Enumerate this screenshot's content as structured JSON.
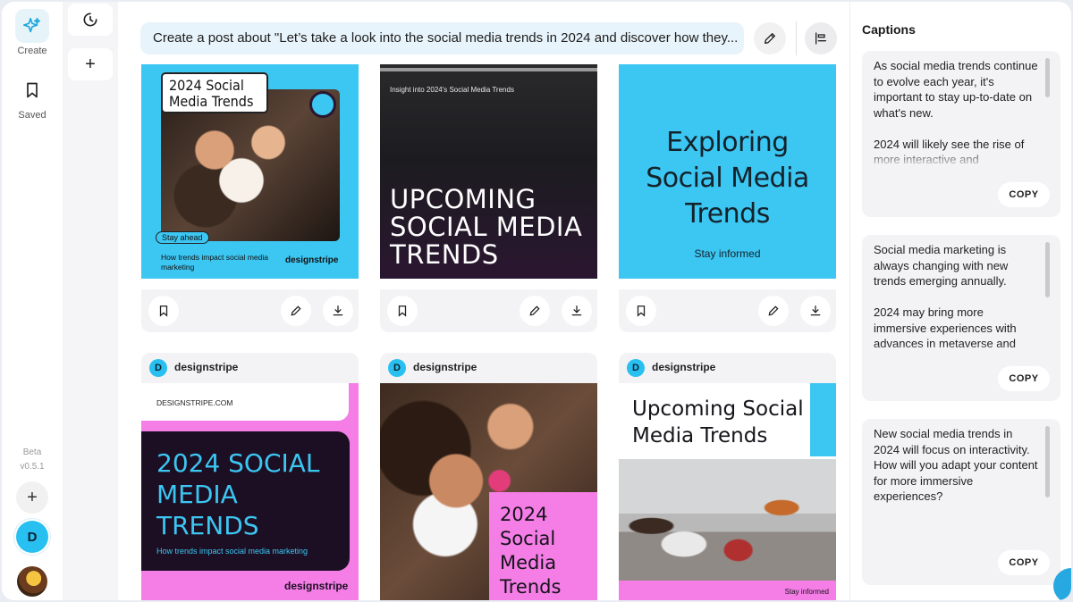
{
  "nav": {
    "create_label": "Create",
    "saved_label": "Saved",
    "beta_label": "Beta",
    "version": "v0.5.1",
    "user_initial": "D"
  },
  "prompt": {
    "text": "Create a post about \"Let’s take a look into the social media trends in 2024 and discover how they..."
  },
  "cards": {
    "c1": {
      "title": "2024 Social Media Trends",
      "tag": "Stay ahead",
      "sub": "How trends impact social media marketing",
      "brand": "designstripe"
    },
    "c2": {
      "top": "Insight into 2024's Social Media Trends",
      "headline": "UPCOMING SOCIAL MEDIA TRENDS"
    },
    "c3": {
      "headline": "Exploring Social Media Trends",
      "sub": "Stay informed"
    },
    "c4": {
      "brand_head": "designstripe",
      "url": "DESIGNSTRIPE.COM",
      "headline": "2024 SOCIAL MEDIA TRENDS",
      "sub": "How trends impact social media marketing",
      "brand": "designstripe"
    },
    "c5": {
      "brand_head": "designstripe",
      "headline": "2024 Social Media Trends"
    },
    "c6": {
      "brand_head": "designstripe",
      "headline": "Upcoming Social Media Trends",
      "sub": "Stay informed"
    }
  },
  "captions": {
    "title": "Captions",
    "copy_label": "COPY",
    "items": [
      {
        "text": "As social media trends continue to evolve each year, it's important to stay up-to-date on what's new.\n\n2024 will likely see the rise of more interactive and"
      },
      {
        "text": "Social media marketing is always changing with new trends emerging annually.\n\n2024 may bring more immersive experiences with advances in metaverse and"
      },
      {
        "text": "New social media trends in 2024 will focus on interactivity. How will you adapt your content for more immersive experiences?"
      }
    ]
  },
  "colors": {
    "accent_cyan": "#3cc6f2",
    "accent_pink": "#f57de6",
    "dark_purple": "#1c0f24"
  }
}
